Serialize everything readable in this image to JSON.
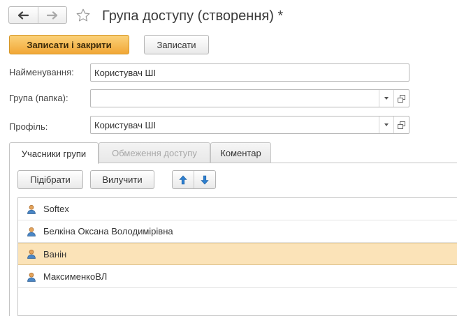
{
  "header": {
    "title": "Група доступу (створення) *",
    "back_icon": "arrow-left-icon",
    "forward_icon": "arrow-right-icon",
    "favorite_icon": "star-icon"
  },
  "toolbar": {
    "save_close_label": "Записати і закрити",
    "save_label": "Записати"
  },
  "form": {
    "name_label": "Найменування:",
    "name_value": "Користувач ШІ",
    "group_label": "Група (папка):",
    "group_value": "",
    "profile_label": "Профіль:",
    "profile_value": "Користувач ШІ"
  },
  "tabs": [
    {
      "label": "Учасники групи",
      "state": "active"
    },
    {
      "label": "Обмеження доступу",
      "state": "disabled"
    },
    {
      "label": "Коментар",
      "state": "normal"
    }
  ],
  "members_toolbar": {
    "pick_label": "Підібрати",
    "remove_label": "Вилучити",
    "up_icon": "arrow-up-icon",
    "down_icon": "arrow-down-icon"
  },
  "members": [
    {
      "name": "Softex",
      "selected": false
    },
    {
      "name": "Белкіна Оксана Володимірівна",
      "selected": false
    },
    {
      "name": "Ванін",
      "selected": true
    },
    {
      "name": "МаксименкоВЛ",
      "selected": false
    }
  ],
  "colors": {
    "primary_button": "#f1a736",
    "selected_row": "#fbe3b8",
    "arrow_blue": "#2d7fd0"
  }
}
